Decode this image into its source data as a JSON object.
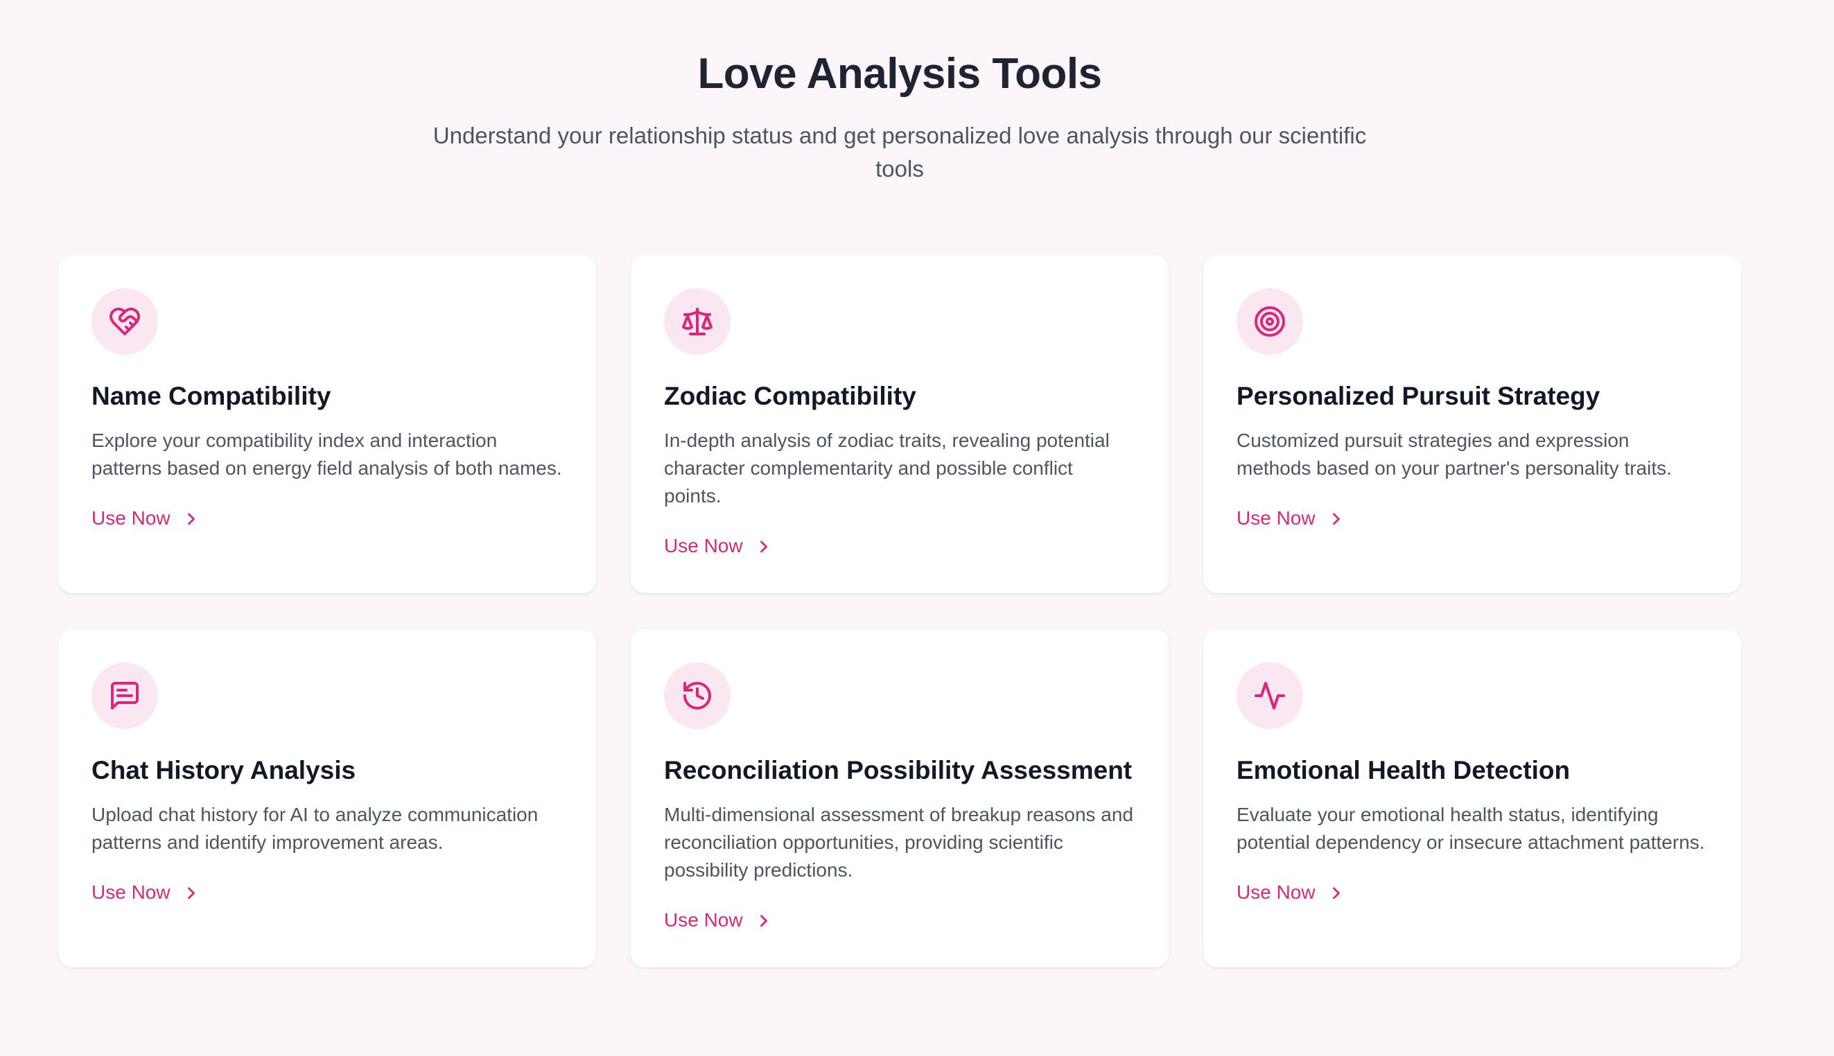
{
  "header": {
    "title": "Love Analysis Tools",
    "subtitle": "Understand your relationship status and get personalized love analysis through our scientific tools"
  },
  "colors": {
    "accent": "#db2777",
    "icon_bg": "#fbe7f1",
    "page_bg": "#fcf5f9"
  },
  "tools": [
    {
      "icon": "heart-handshake-icon",
      "title": "Name Compatibility",
      "description": "Explore your compatibility index and interaction patterns based on energy field analysis of both names.",
      "action": "Use Now"
    },
    {
      "icon": "scale-icon",
      "title": "Zodiac Compatibility",
      "description": "In-depth analysis of zodiac traits, revealing potential character complementarity and possible conflict points.",
      "action": "Use Now"
    },
    {
      "icon": "target-icon",
      "title": "Personalized Pursuit Strategy",
      "description": "Customized pursuit strategies and expression methods based on your partner's personality traits.",
      "action": "Use Now"
    },
    {
      "icon": "message-square-text-icon",
      "title": "Chat History Analysis",
      "description": "Upload chat history for AI to analyze communication patterns and identify improvement areas.",
      "action": "Use Now"
    },
    {
      "icon": "history-icon",
      "title": "Reconciliation Possibility Assessment",
      "description": "Multi-dimensional assessment of breakup reasons and reconciliation opportunities, providing scientific possibility predictions.",
      "action": "Use Now"
    },
    {
      "icon": "activity-icon",
      "title": "Emotional Health Detection",
      "description": "Evaluate your emotional health status, identifying potential dependency or insecure attachment patterns.",
      "action": "Use Now"
    }
  ]
}
